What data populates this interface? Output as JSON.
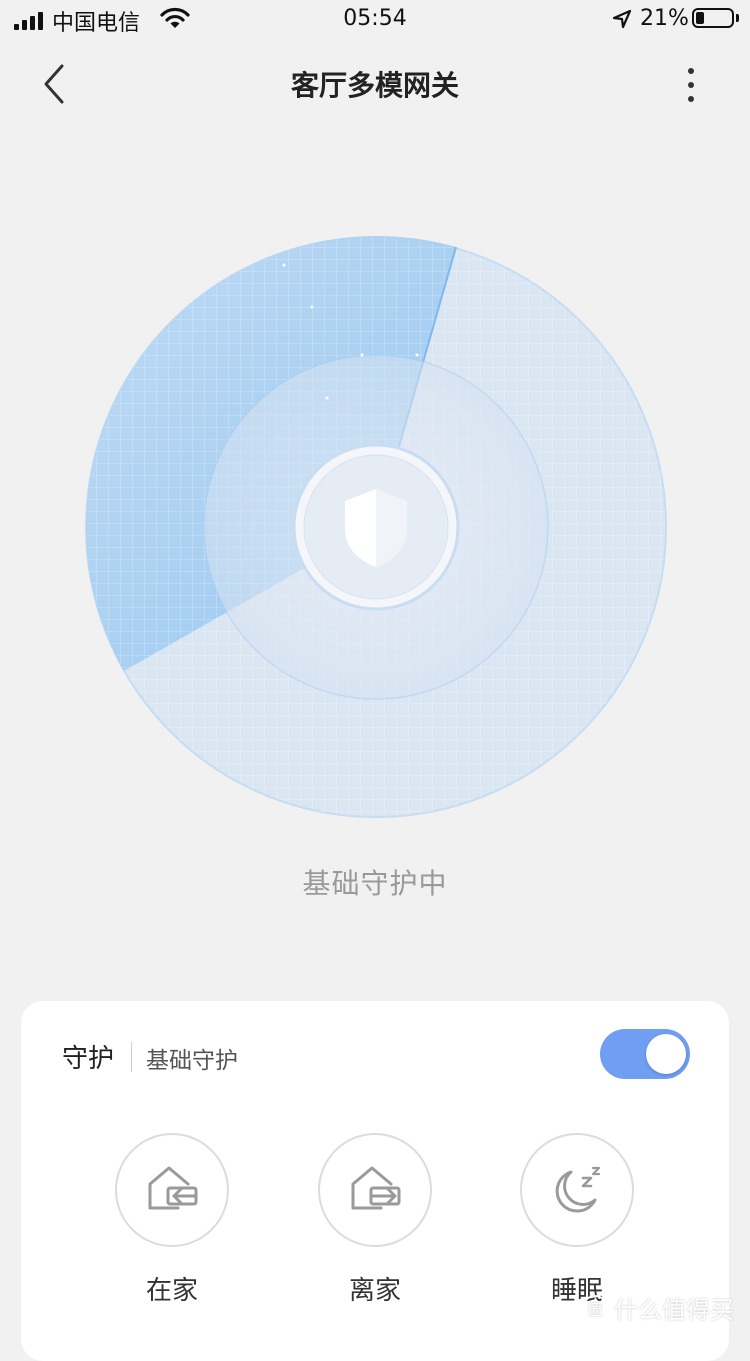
{
  "status_bar": {
    "carrier": "中国电信",
    "time": "05:54",
    "battery": "21%",
    "battery_level": 0.21
  },
  "nav": {
    "title": "客厅多模网关",
    "back_icon": "chevron-left-icon",
    "more_icon": "more-vertical-icon"
  },
  "radar": {
    "shield_icon": "shield-icon",
    "status": "基础守护中"
  },
  "guard": {
    "label": "守护",
    "mode": "基础守护",
    "enabled": true,
    "accent": "#6f9ef3"
  },
  "modes": [
    {
      "label": "在家",
      "icon": "home-arrive-icon"
    },
    {
      "label": "离家",
      "icon": "home-leave-icon"
    },
    {
      "label": "睡眠",
      "icon": "moon-sleep-icon"
    }
  ],
  "watermark": {
    "badge": "值",
    "text": "什么值得买"
  }
}
